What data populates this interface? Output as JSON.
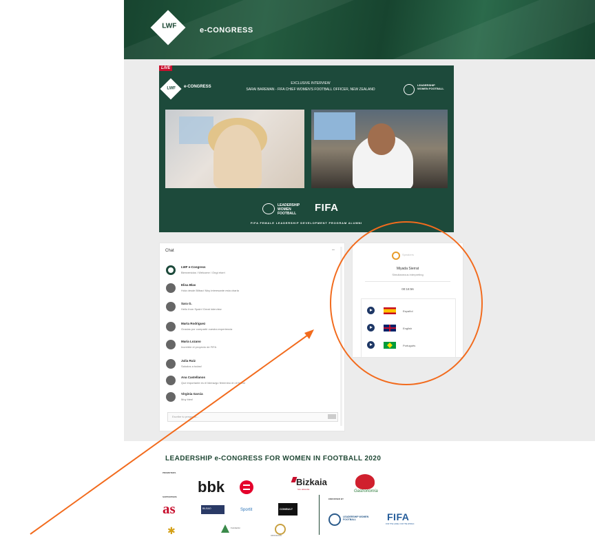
{
  "header": {
    "logo_text": "LWF",
    "title": "e-CONGRESS"
  },
  "video": {
    "live_badge": "LIVE",
    "logo_text": "LWF",
    "econgress_text": "e-CONGRESS",
    "session_line1": "EXCLUSIVE INTERVIEW",
    "session_line2": "SARAI BAREMAN - FIFA CHIEF WOMEN'S FOOTBALL OFFICER, NEW ZEALAND",
    "right_logo_text": "LEADERSHIP WOMEN FOOTBALL",
    "footer_lwf_text": "LEADERSHIP WOMEN FOOTBALL",
    "footer_fifa": "FIFA",
    "caption": "FIFA FEMALE LEADERSHIP DEVELOPMENT PROGRAM ALUMNI"
  },
  "chat": {
    "header": "Chat",
    "messages": [
      {
        "name": "LWF e-Congress",
        "text": "Bienvenidos / Welcome / Ongi etorri"
      },
      {
        "name": "Elisa Blas",
        "text": "Hola desde Bilbao! Muy interesante esta charla"
      },
      {
        "name": "Sara G.",
        "text": "Hello from Spain! Great interview"
      },
      {
        "name": "Marta Rodriguez",
        "text": "Gracias por compartir vuestra experiencia"
      },
      {
        "name": "María Lozano",
        "text": "Increíble el proyecto de FIFA"
      },
      {
        "name": "Julia Ruiz",
        "text": "Saludos a todas!"
      },
      {
        "name": "Ana Castellanos",
        "text": "Que importante es el liderazgo femenino en el fútbol"
      },
      {
        "name": "Virginia Garcia",
        "text": "Muy bien!"
      }
    ],
    "input_placeholder": "Escribe tu pregunta..."
  },
  "audio": {
    "brand": "Speakers",
    "speaker_name": "Miyada Sierrat",
    "speaker_sub": "Simultaneous interpreting",
    "time": "00:18:56",
    "languages": [
      {
        "label": "Español",
        "flag": "es"
      },
      {
        "label": "English",
        "flag": "uk"
      },
      {
        "label": "Português",
        "flag": "br"
      }
    ]
  },
  "footer": {
    "title": "LEADERSHIP e-CONGRESS FOR WOMEN IN FOOTBALL 2020",
    "sponsor_label": "PROMOTERS",
    "supporter_label": "SUPPORTERS",
    "endorsed_label": "ENDORSED BY",
    "bbk": "bbk",
    "bizkaia": "Bizkaia",
    "bizkaia_sub": "foru aldundia",
    "basque_brand": "Gastronomía",
    "as": "as",
    "sp1": "BILBAO",
    "sportit": "Sportit",
    "sp2": "CONSULT",
    "endorsed_org": "LEADERSHIP WOMEN FOOTBALL",
    "fifa": "FIFA",
    "fifa_sub": "FOR THE GAME. FOR THE WORLD.",
    "tree_txt": "Fundación",
    "ball_txt": "ASOCIACIÓN"
  },
  "colors": {
    "brand_green": "#17442f",
    "annotation": "#f26b1d",
    "live_red": "#c8102e"
  }
}
